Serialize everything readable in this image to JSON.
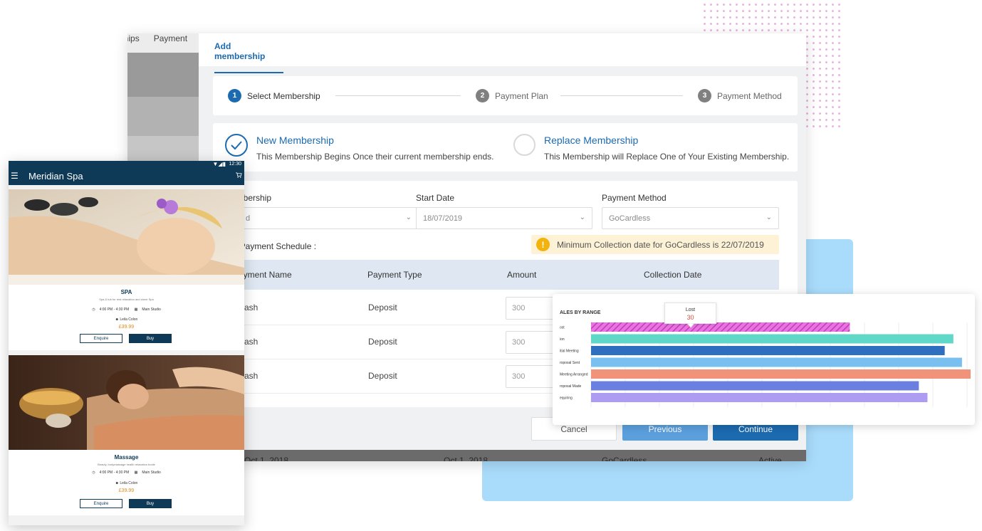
{
  "background": {
    "tabs": [
      "nships",
      "Payment"
    ],
    "footer_row": [
      "Oct 1, 2018",
      "Oct 1, 2018",
      "GoCardless",
      "Active"
    ]
  },
  "modal": {
    "tab": "Add membership",
    "steps": [
      {
        "num": "1",
        "label": "Select Membership",
        "state": "active"
      },
      {
        "num": "2",
        "label": "Payment Plan",
        "state": "pending"
      },
      {
        "num": "3",
        "label": "Payment Method",
        "state": "pending"
      }
    ],
    "options": {
      "new": {
        "title": "New Membership",
        "desc": "This Membership Begins Once their current membership ends."
      },
      "replace": {
        "title": "Replace Membership",
        "desc": "This Membership will Replace One of Your Existing Membership."
      }
    },
    "form": {
      "membership_label": "nbership",
      "membership_value": "d",
      "start_label": "Start Date",
      "start_value": "18/07/2019",
      "payment_label": "Payment Method",
      "payment_value": "GoCardless",
      "schedule_label": "st Payment Schedule :",
      "warning": "Minimum Collection date for GoCardless is 22/07/2019"
    },
    "table": {
      "headers": [
        "ayment Name",
        "Payment Type",
        "Amount",
        "Collection Date"
      ],
      "rows": [
        {
          "name": "ash",
          "type": "Deposit",
          "amount": "300"
        },
        {
          "name": "ash",
          "type": "Deposit",
          "amount": "300"
        },
        {
          "name": "ash",
          "type": "Deposit",
          "amount": "300"
        }
      ]
    },
    "buttons": {
      "cancel": "Cancel",
      "previous": "Previous",
      "continue": "Continue"
    }
  },
  "chart_data": {
    "type": "bar",
    "orientation": "horizontal",
    "title": "ALES BY RANGE",
    "categories": [
      "ost",
      "ion",
      "itial Meeting",
      "roposal Sent",
      "Meeting Arranged",
      "roposal Made",
      "equiring"
    ],
    "values": [
      30,
      42,
      41,
      43,
      44,
      38,
      39
    ],
    "colors": [
      "#d84fd0",
      "#5fd8c8",
      "#2f6fc0",
      "#79c0f0",
      "#f0937a",
      "#6b7fe0",
      "#ad9cf2"
    ],
    "hatched": [
      true,
      false,
      false,
      false,
      false,
      false,
      false
    ],
    "xlim": [
      0,
      44
    ],
    "grid": true,
    "tooltip": {
      "label": "Lost",
      "value": "30"
    }
  },
  "phone": {
    "time": "12:30",
    "app_title": "Meridian Spa",
    "services": [
      {
        "name": "SPA",
        "desc": "Spa & tub for rest relaxation and stone Spa",
        "time": "4:00 PM - 4:30 PM",
        "room": "Main Studio",
        "staff": "Leila Colon",
        "price": "£39.99",
        "enquire": "Enquire",
        "buy": "Buy"
      },
      {
        "name": "Massage",
        "desc": "Beauty, bodymassage health relaxation bodie",
        "time": "4:00 PM - 4:30 PM",
        "room": "Main Studio",
        "staff": "Leila Colon",
        "price": "£39.99",
        "enquire": "Enquire",
        "buy": "Buy"
      }
    ]
  },
  "colors": {
    "primary": "#1c6ab0",
    "app_bar": "#0f3a57",
    "price": "#e28a1a",
    "warning_bg": "#fdf1d6"
  }
}
